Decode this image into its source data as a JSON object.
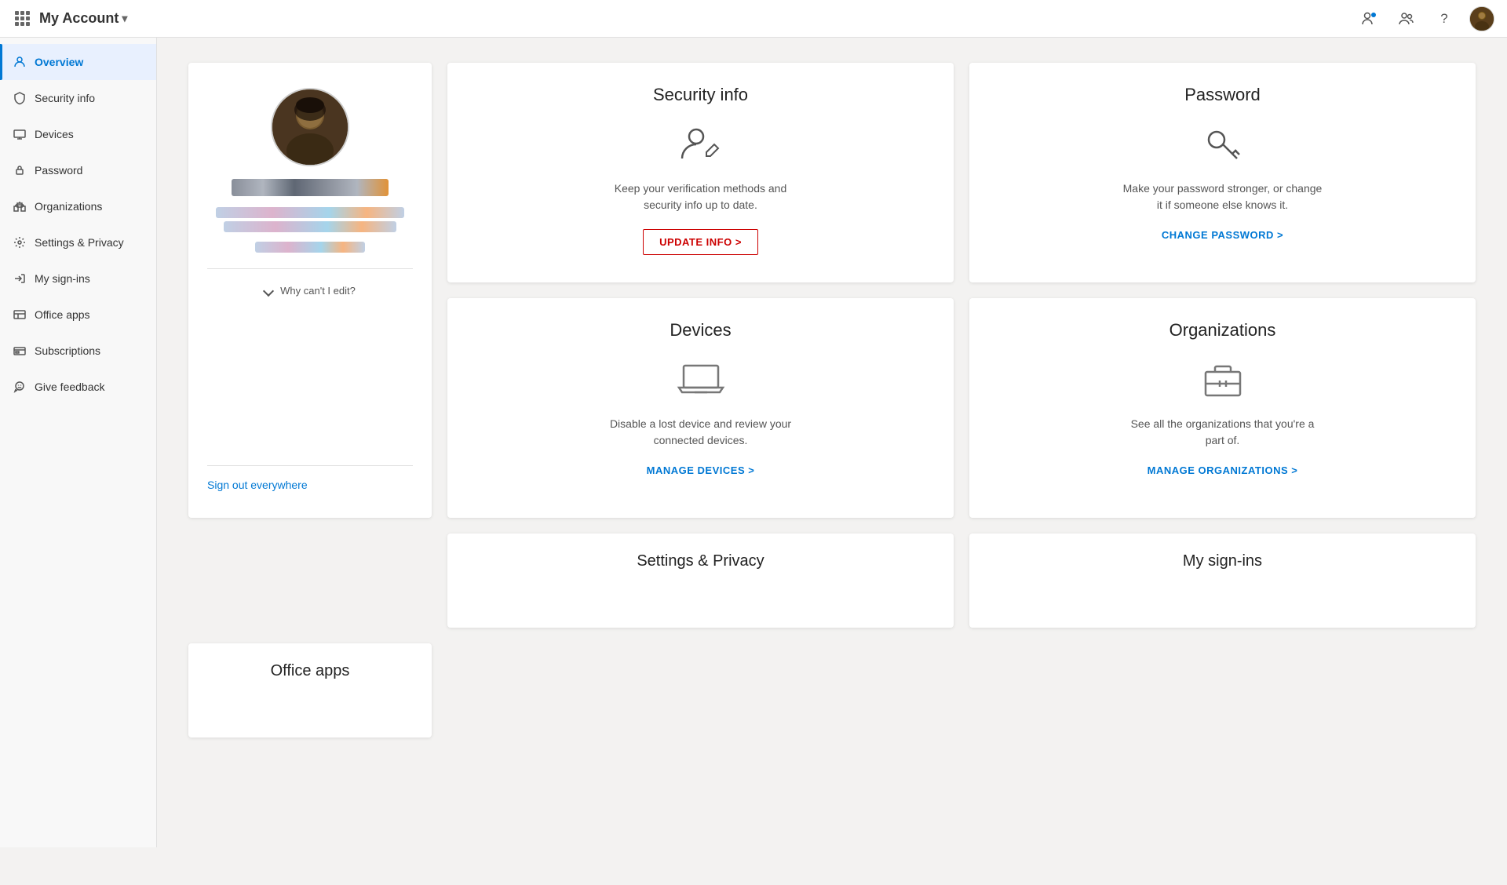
{
  "topnav": {
    "app_title": "My Account",
    "chevron": "▾",
    "icons": {
      "notification": "🔔",
      "people": "👥",
      "help": "?"
    }
  },
  "sidebar": {
    "items": [
      {
        "id": "overview",
        "label": "Overview",
        "icon": "person",
        "active": true
      },
      {
        "id": "security-info",
        "label": "Security info",
        "icon": "shield"
      },
      {
        "id": "devices",
        "label": "Devices",
        "icon": "laptop"
      },
      {
        "id": "password",
        "label": "Password",
        "icon": "lock"
      },
      {
        "id": "organizations",
        "label": "Organizations",
        "icon": "building"
      },
      {
        "id": "settings-privacy",
        "label": "Settings & Privacy",
        "icon": "settings"
      },
      {
        "id": "my-sign-ins",
        "label": "My sign-ins",
        "icon": "signin"
      },
      {
        "id": "office-apps",
        "label": "Office apps",
        "icon": "office"
      },
      {
        "id": "subscriptions",
        "label": "Subscriptions",
        "icon": "subscription"
      },
      {
        "id": "give-feedback",
        "label": "Give feedback",
        "icon": "feedback"
      }
    ]
  },
  "profile": {
    "name_placeholder": "Aryan Mishra",
    "why_cant_edit": "Why can't I edit?",
    "sign_out_everywhere": "Sign out everywhere"
  },
  "security_info_card": {
    "title": "Security info",
    "description": "Keep your verification methods and security info up to date.",
    "action_label": "UPDATE INFO >"
  },
  "password_card": {
    "title": "Password",
    "description": "Make your password stronger, or change it if someone else knows it.",
    "action_label": "CHANGE PASSWORD >"
  },
  "devices_card": {
    "title": "Devices",
    "description": "Disable a lost device and review your connected devices.",
    "action_label": "MANAGE DEVICES >"
  },
  "organizations_card": {
    "title": "Organizations",
    "description": "See all the organizations that you're a part of.",
    "action_label": "MANAGE ORGANIZATIONS >"
  },
  "bottom_cards": {
    "settings_privacy": {
      "title": "Settings & Privacy"
    },
    "my_sign_ins": {
      "title": "My sign-ins"
    },
    "office_apps": {
      "title": "Office apps"
    }
  }
}
